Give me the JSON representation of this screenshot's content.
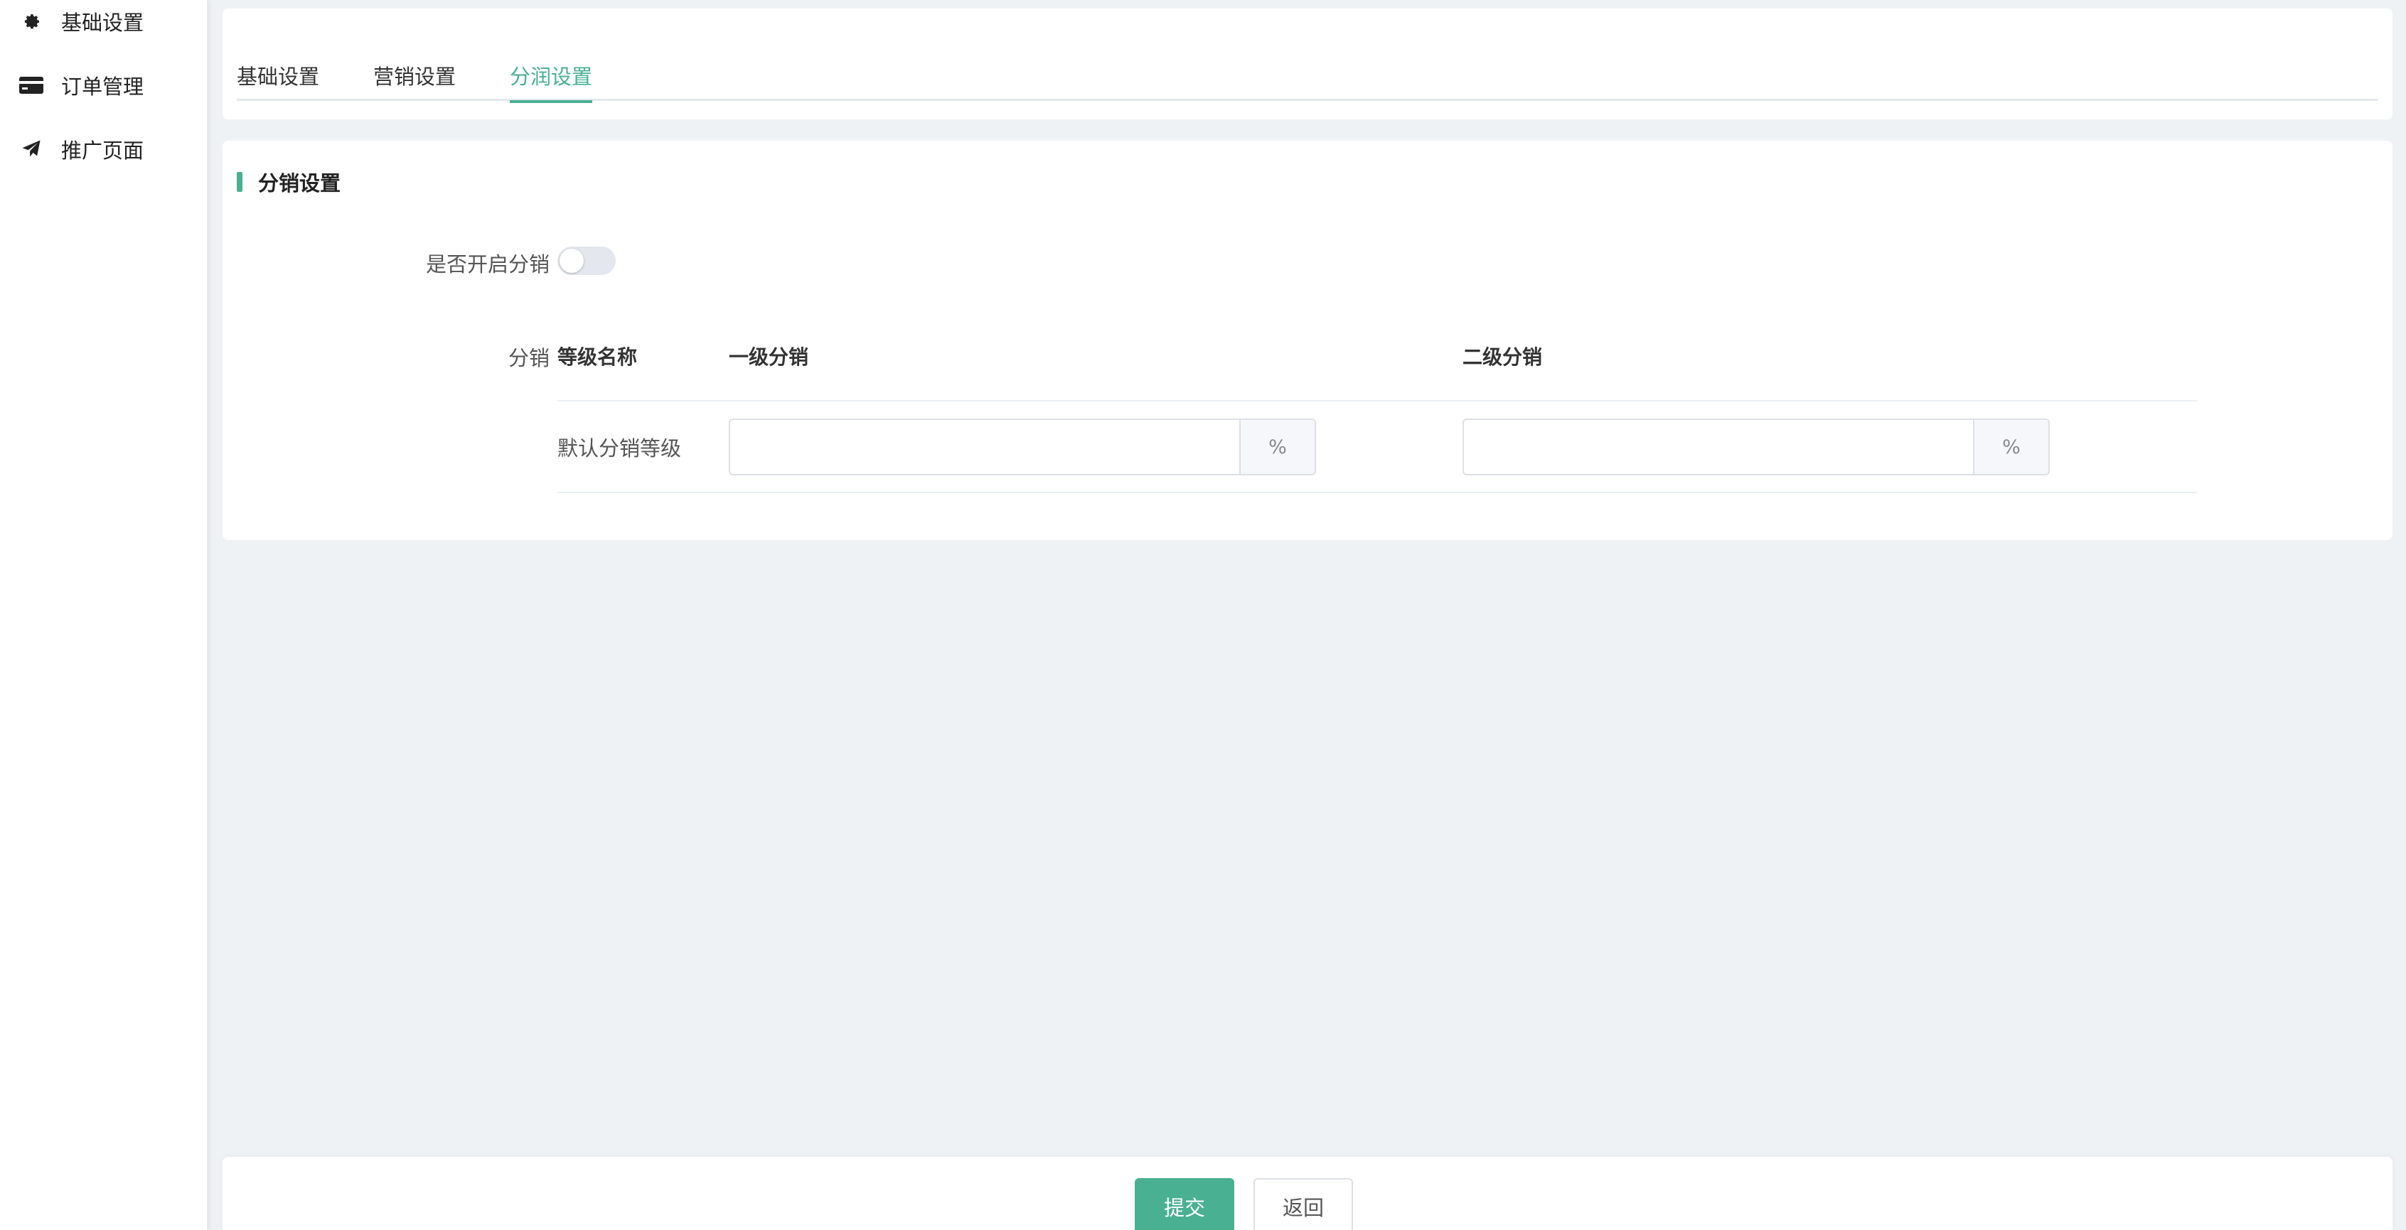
{
  "sidebar": {
    "items": [
      {
        "label": "基础设置",
        "icon": "gear-icon"
      },
      {
        "label": "订单管理",
        "icon": "card-icon"
      },
      {
        "label": "推广页面",
        "icon": "paper-plane-icon"
      }
    ]
  },
  "tabs": [
    {
      "label": "基础设置",
      "active": false
    },
    {
      "label": "营销设置",
      "active": false
    },
    {
      "label": "分润设置",
      "active": true
    }
  ],
  "section": {
    "title": "分销设置",
    "enable_label": "是否开启分销",
    "enable_value": false,
    "distribution_label": "分销",
    "table": {
      "headers": [
        "等级名称",
        "一级分销",
        "二级分销"
      ],
      "rows": [
        {
          "name": "默认分销等级",
          "level1": "",
          "level2": "",
          "unit": "%"
        }
      ]
    }
  },
  "footer": {
    "submit_label": "提交",
    "back_label": "返回"
  },
  "colors": {
    "accent": "#49b091"
  }
}
